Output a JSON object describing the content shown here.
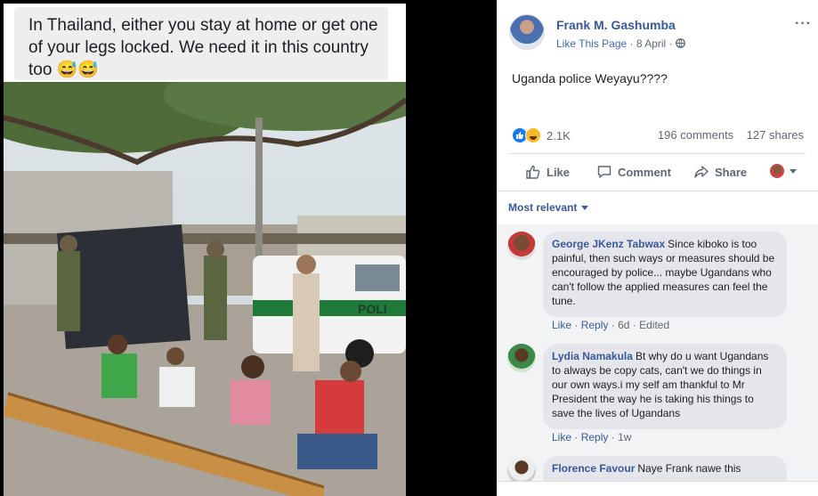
{
  "meme": {
    "caption": "In Thailand, either you stay at home or get one of your legs locked. We need it in this country too 😅😅",
    "truck_text": "POLI"
  },
  "post": {
    "page_name": "Frank M. Gashumba",
    "like_page": "Like This Page",
    "date": "8 April",
    "text": "Uganda police Weyayu????",
    "reaction_count": "2.1K",
    "comments_count": "196 comments",
    "shares_count": "127 shares"
  },
  "actions": {
    "like": "Like",
    "comment": "Comment",
    "share": "Share"
  },
  "comments_filter": "Most relevant",
  "comments": [
    {
      "name": "George JKenz Tabwax",
      "text": "Since kiboko is too painful, then such ways or measures should be encouraged by police... maybe Ugandans who can't follow the applied measures can feel the tune.",
      "like": "Like",
      "reply": "Reply",
      "time": "6d",
      "edited": "Edited"
    },
    {
      "name": "Lydia Namakula",
      "text": "Bt why do u want Ugandans to always be copy cats, can't we do things in our own ways.i my self am thankful to Mr President the way he is taking his things to save the lives of Ugandans",
      "like": "Like",
      "reply": "Reply",
      "time": "1w"
    },
    {
      "name": "Florence Favour",
      "text": "Naye Frank nawe this"
    }
  ],
  "colors": {
    "link": "#385898",
    "bubble": "#e4e6eb",
    "like_blue": "#1877f2",
    "haha_yellow": "#f7b928"
  }
}
